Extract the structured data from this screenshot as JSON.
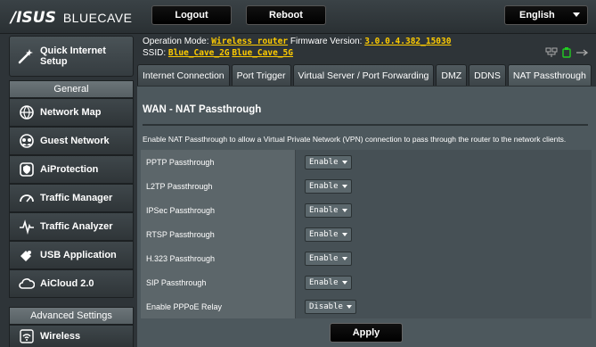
{
  "header": {
    "brand": "/ISUS",
    "model": "BLUECAVE",
    "logout_label": "Logout",
    "reboot_label": "Reboot",
    "language_label": "English"
  },
  "status": {
    "opmode_prefix": "Operation Mode:",
    "opmode_value": "Wireless router",
    "firmware_prefix": "Firmware Version:",
    "firmware_value": "3.0.0.4.382_15030",
    "ssid_prefix": "SSID:",
    "ssid_2g": "Blue_Cave_2G",
    "ssid_5g": "Blue_Cave_5G"
  },
  "sidebar": {
    "quick_setup_label": "Quick Internet\nSetup",
    "general_heading": "General",
    "general_items": [
      {
        "label": "Network Map",
        "icon": "network-map-icon"
      },
      {
        "label": "Guest Network",
        "icon": "guest-network-icon"
      },
      {
        "label": "AiProtection",
        "icon": "shield-icon"
      },
      {
        "label": "Traffic Manager",
        "icon": "gauge-icon"
      },
      {
        "label": "Traffic Analyzer",
        "icon": "pulse-icon"
      },
      {
        "label": "USB Application",
        "icon": "puzzle-icon"
      },
      {
        "label": "AiCloud 2.0",
        "icon": "cloud-icon"
      }
    ],
    "advanced_heading": "Advanced Settings",
    "advanced_items": [
      {
        "label": "Wireless",
        "icon": "wifi-icon"
      }
    ]
  },
  "tabs": [
    {
      "label": "Internet Connection",
      "active": false
    },
    {
      "label": "Port Trigger",
      "active": false
    },
    {
      "label": "Virtual Server / Port Forwarding",
      "active": false
    },
    {
      "label": "DMZ",
      "active": false
    },
    {
      "label": "DDNS",
      "active": false
    },
    {
      "label": "NAT Passthrough",
      "active": true
    }
  ],
  "main": {
    "title": "WAN - NAT Passthrough",
    "description": "Enable NAT Passthrough to allow a Virtual Private Network (VPN) connection to pass through the router to the network clients.",
    "rows": [
      {
        "label": "PPTP Passthrough",
        "value": "Enable"
      },
      {
        "label": "L2TP Passthrough",
        "value": "Enable"
      },
      {
        "label": "IPSec Passthrough",
        "value": "Enable"
      },
      {
        "label": "RTSP Passthrough",
        "value": "Enable"
      },
      {
        "label": "H.323 Passthrough",
        "value": "Enable"
      },
      {
        "label": "SIP Passthrough",
        "value": "Enable"
      },
      {
        "label": "Enable PPPoE Relay",
        "value": "Disable"
      }
    ],
    "apply_label": "Apply"
  },
  "colors": {
    "accent_link": "#ffcc00",
    "status_green": "#22cc22",
    "panel": "#4d585d"
  }
}
